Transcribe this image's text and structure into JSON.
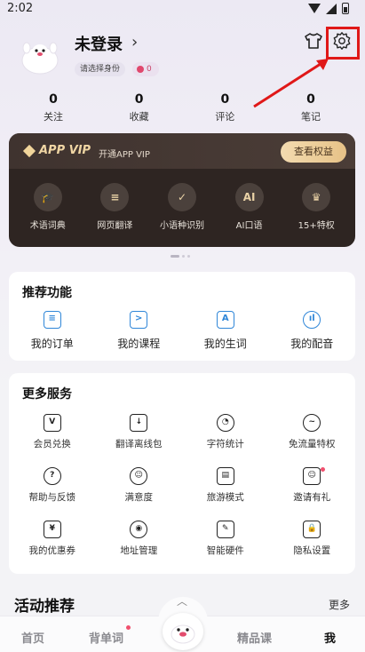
{
  "status_bar": {
    "time": "2:02"
  },
  "profile": {
    "username": "未登录",
    "chevron": "›",
    "identity_badge": "请选择身份",
    "coins": "0"
  },
  "stats": [
    {
      "value": "0",
      "label": "关注"
    },
    {
      "value": "0",
      "label": "收藏"
    },
    {
      "value": "0",
      "label": "评论"
    },
    {
      "value": "0",
      "label": "笔记"
    }
  ],
  "vip": {
    "title": "APP VIP",
    "subtitle": "开通APP VIP",
    "button": "查看权益",
    "items": [
      {
        "label": "术语词典",
        "icon": "graduation-cap-icon",
        "glyph": "🎓"
      },
      {
        "label": "网页翻译",
        "icon": "document-icon",
        "glyph": "≡"
      },
      {
        "label": "小语种识别",
        "icon": "shield-check-icon",
        "glyph": "✓"
      },
      {
        "label": "AI口语",
        "icon": "ai-speech-icon",
        "glyph": "AI"
      },
      {
        "label": "15+特权",
        "icon": "crown-icon",
        "glyph": "♛"
      }
    ]
  },
  "recommend": {
    "title": "推荐功能",
    "items": [
      {
        "label": "我的订单",
        "icon": "order-list-icon",
        "glyph": "≡"
      },
      {
        "label": "我的课程",
        "icon": "video-course-icon",
        "glyph": ">"
      },
      {
        "label": "我的生词",
        "icon": "word-book-icon",
        "glyph": "A"
      },
      {
        "label": "我的配音",
        "icon": "audio-wave-icon",
        "glyph": "ıl"
      }
    ]
  },
  "services": {
    "title": "更多服务",
    "items": [
      {
        "label": "会员兑换",
        "icon": "vip-exchange-icon",
        "glyph": "V"
      },
      {
        "label": "翻译离线包",
        "icon": "download-icon",
        "glyph": "↓"
      },
      {
        "label": "字符统计",
        "icon": "pie-chart-icon",
        "glyph": "◔"
      },
      {
        "label": "免流量特权",
        "icon": "data-trend-icon",
        "glyph": "~"
      },
      {
        "label": "帮助与反馈",
        "icon": "help-icon",
        "glyph": "?"
      },
      {
        "label": "满意度",
        "icon": "smile-icon",
        "glyph": "☺"
      },
      {
        "label": "旅游模式",
        "icon": "suitcase-icon",
        "glyph": "▤"
      },
      {
        "label": "邀请有礼",
        "icon": "invite-icon",
        "glyph": "☺"
      },
      {
        "label": "我的优惠券",
        "icon": "coupon-icon",
        "glyph": "¥"
      },
      {
        "label": "地址管理",
        "icon": "location-pin-icon",
        "glyph": "◉"
      },
      {
        "label": "智能硬件",
        "icon": "smart-pen-icon",
        "glyph": "✎"
      },
      {
        "label": "隐私设置",
        "icon": "lock-icon",
        "glyph": "🔒"
      }
    ]
  },
  "activity": {
    "title": "活动推荐",
    "more": "更多"
  },
  "bottom_nav": {
    "home": "首页",
    "words": "背单词",
    "courses": "精品课",
    "me": "我"
  },
  "colors": {
    "accent_blue": "#2f86d8",
    "vip_gold": "#f0d6a4",
    "highlight_red": "#e01818",
    "notification_red": "#f0506e"
  }
}
